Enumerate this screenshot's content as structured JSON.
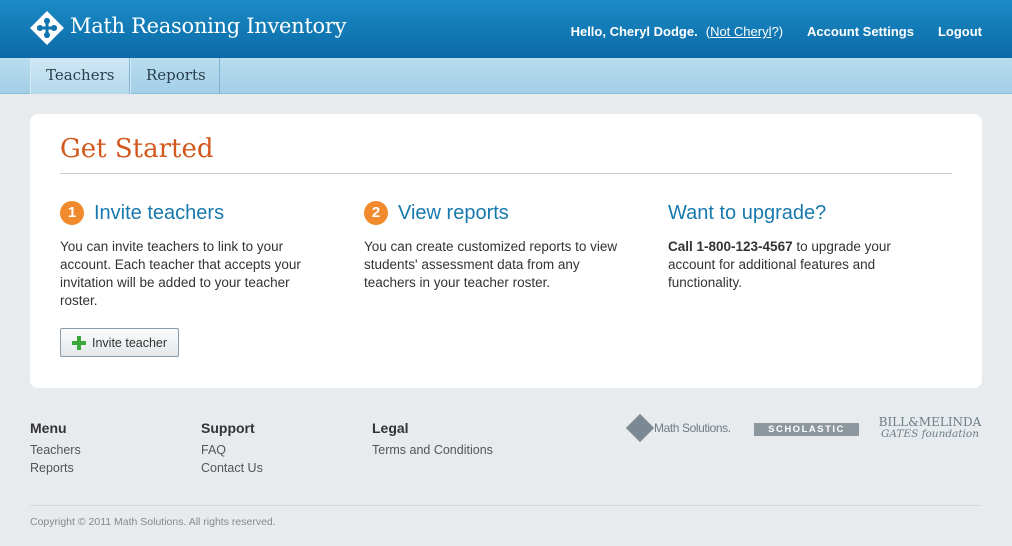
{
  "header": {
    "app_title": "Math Reasoning Inventory",
    "greeting": "Hello, Cheryl Dodge.",
    "not_user_prefix": "(",
    "not_user_link": "Not Cheryl",
    "not_user_suffix": "?)",
    "account_settings": "Account Settings",
    "logout": "Logout"
  },
  "nav": {
    "tabs": [
      {
        "label": "Teachers",
        "active": true
      },
      {
        "label": "Reports",
        "active": false
      }
    ]
  },
  "main": {
    "title": "Get Started",
    "steps": [
      {
        "number": "1",
        "title": "Invite teachers",
        "text": "You can invite teachers to link to your account. Each teacher that accepts your invitation will be added to your teacher roster."
      },
      {
        "number": "2",
        "title": "View reports",
        "text": "You can create customized reports to view students' assessment data from any teachers in your teacher roster."
      }
    ],
    "upgrade": {
      "title": "Want to upgrade?",
      "phone_bold": "Call 1-800-123-4567",
      "text": " to upgrade your account for additional features and functionality."
    },
    "invite_button": "Invite teacher"
  },
  "footer": {
    "menu": {
      "heading": "Menu",
      "links": [
        "Teachers",
        "Reports"
      ]
    },
    "support": {
      "heading": "Support",
      "links": [
        "FAQ",
        "Contact Us"
      ]
    },
    "legal": {
      "heading": "Legal",
      "links": [
        "Terms and Conditions"
      ]
    },
    "sponsors": {
      "math_solutions": "Math Solutions.",
      "scholastic": "SCHOLASTIC",
      "gates_line1": "BILL&MELINDA",
      "gates_line2": "GATES foundation"
    },
    "copyright": "Copyright © 2011 Math Solutions. All rights reserved."
  },
  "colors": {
    "header_blue": "#0b6aa6",
    "accent_orange": "#d3581d",
    "step_orange": "#f08a2c",
    "link_blue": "#1779ad"
  }
}
